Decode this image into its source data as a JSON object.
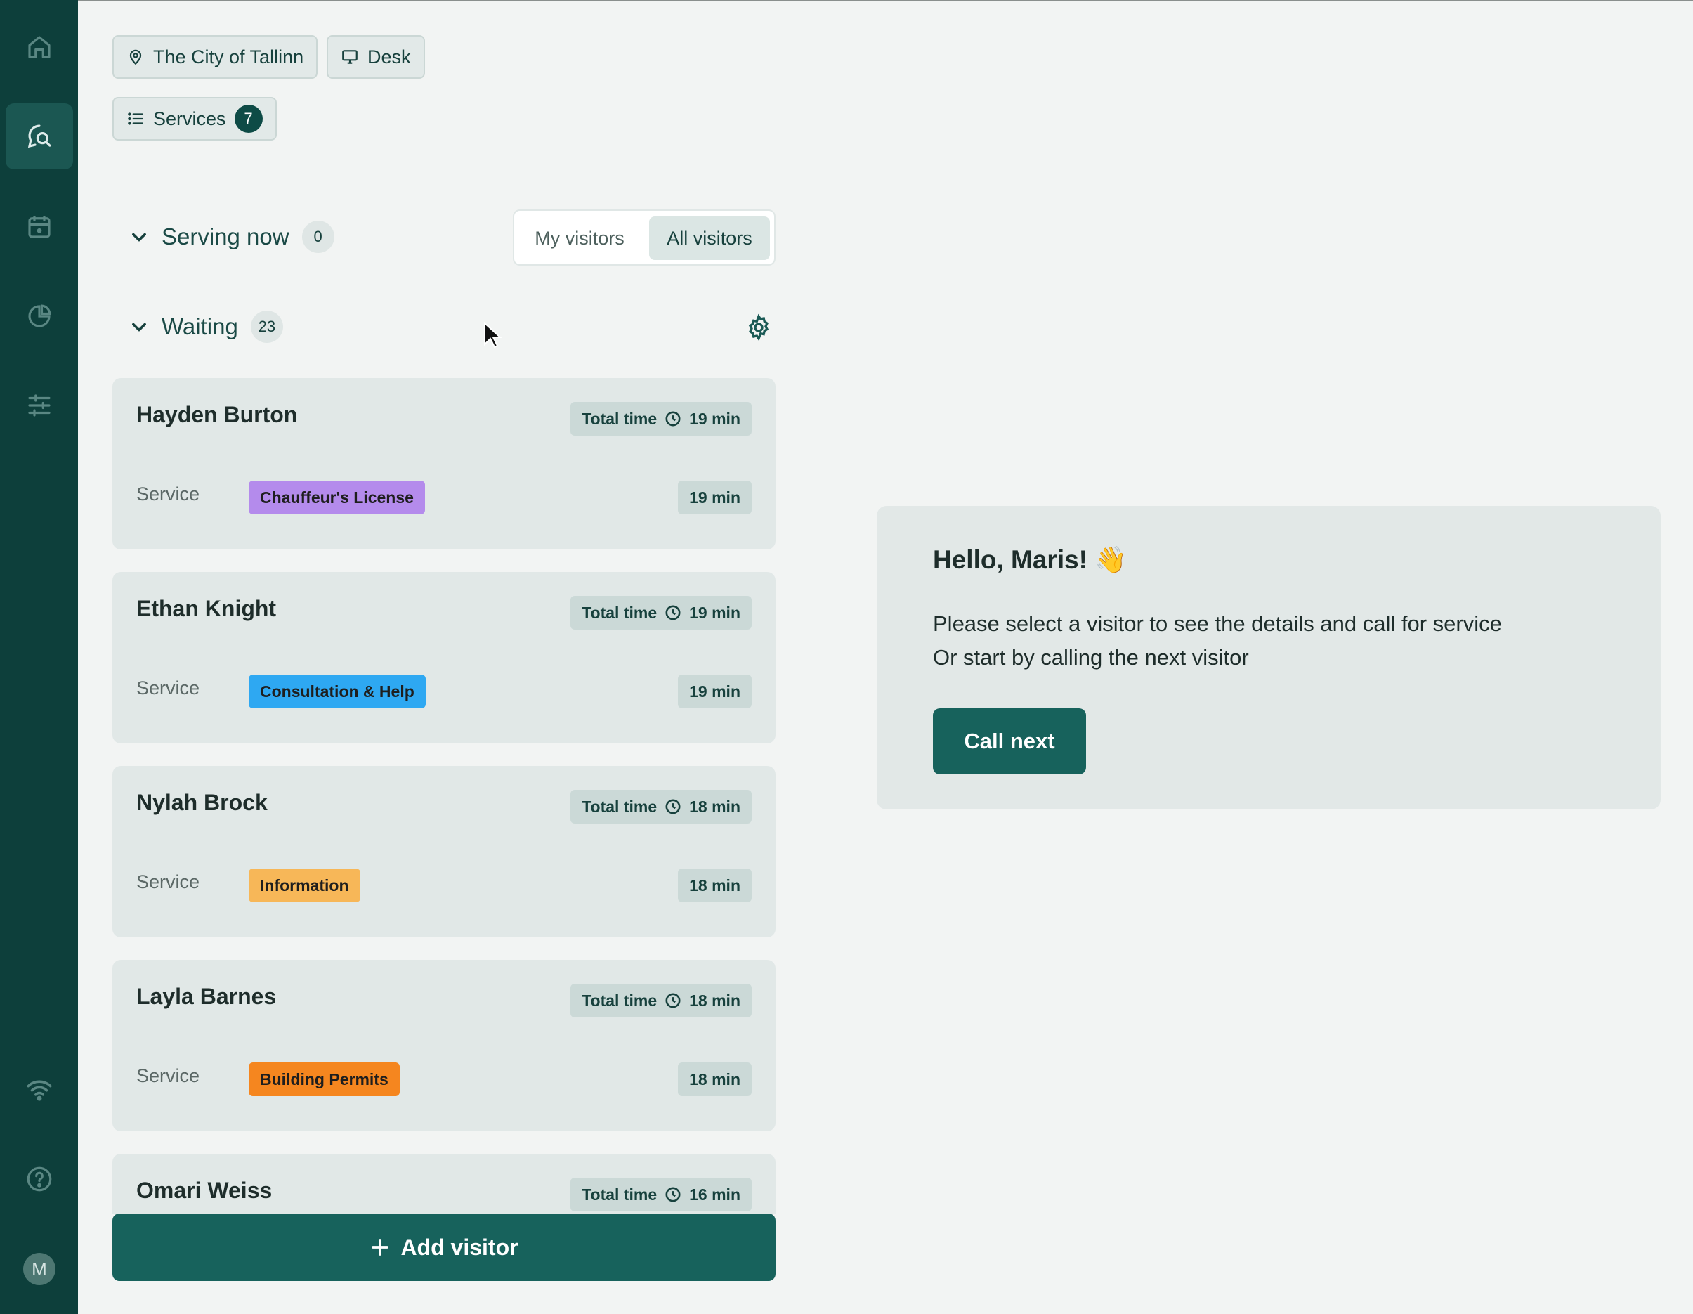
{
  "sidebar": {
    "nav": [
      {
        "icon": "home-icon",
        "active": false
      },
      {
        "icon": "chat-search-icon",
        "active": true
      },
      {
        "icon": "calendar-icon",
        "active": false
      },
      {
        "icon": "pie-chart-icon",
        "active": false
      },
      {
        "icon": "sliders-icon",
        "active": false
      }
    ],
    "bottom": [
      {
        "icon": "wifi-icon"
      },
      {
        "icon": "help-icon"
      }
    ],
    "avatar_initial": "M"
  },
  "filters": {
    "location": "The City of Tallinn",
    "desk": "Desk",
    "services_label": "Services",
    "services_count": "7"
  },
  "serving_now": {
    "title": "Serving now",
    "count": "0",
    "toggle": {
      "my_visitors": "My visitors",
      "all_visitors": "All visitors",
      "selected": "all_visitors"
    }
  },
  "waiting": {
    "title": "Waiting",
    "count": "23",
    "service_label": "Service",
    "total_label": "Total time",
    "visitors": [
      {
        "name": "Hayden Burton",
        "total": "19 min",
        "service": "Chauffeur's License",
        "service_color": "#b48bec",
        "duration": "19 min"
      },
      {
        "name": "Ethan Knight",
        "total": "19 min",
        "service": "Consultation & Help",
        "service_color": "#2ea8f2",
        "duration": "19 min"
      },
      {
        "name": "Nylah Brock",
        "total": "18 min",
        "service": "Information",
        "service_color": "#f7b758",
        "duration": "18 min"
      },
      {
        "name": "Layla Barnes",
        "total": "18 min",
        "service": "Building Permits",
        "service_color": "#f5861f",
        "duration": "18 min"
      },
      {
        "name": "Omari Weiss",
        "total": "16 min",
        "service": "",
        "service_color": "",
        "duration": ""
      }
    ],
    "add_visitor": "Add visitor"
  },
  "welcome": {
    "title": "Hello, Maris! 👋",
    "line1": "Please select a visitor to see the details and call for service",
    "line2": "Or start by calling the next visitor",
    "call_next": "Call next"
  },
  "colors": {
    "sidebar": "#0d3f3b",
    "primary": "#17625c",
    "background": "#f2f4f3"
  }
}
